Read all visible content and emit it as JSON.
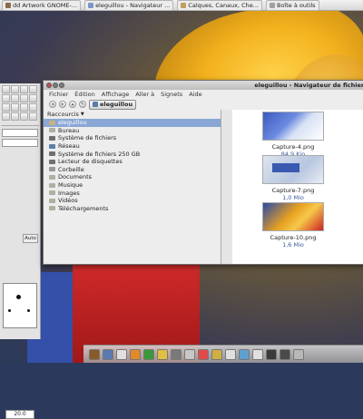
{
  "taskbar": {
    "tasks": [
      {
        "label": "dd Artwork GNOME-...",
        "kind": "gimp"
      },
      {
        "label": "eleguillou - Navigateur ...",
        "kind": "nav"
      },
      {
        "label": "Calques, Canaux, Che...",
        "kind": "layers"
      },
      {
        "label": "Boîte à outils",
        "kind": "tools"
      }
    ]
  },
  "toolbox": {
    "auto_label": "Auto",
    "brush_value": "20.0"
  },
  "window": {
    "title": "eleguillou - Navigateur de fichiers",
    "menu": [
      "Fichier",
      "Édition",
      "Affichage",
      "Aller à",
      "Signets",
      "Aide"
    ],
    "path_button": "eleguillou"
  },
  "sidebar": {
    "header": "Raccourcis",
    "items": [
      {
        "label": "eleguillou",
        "icon": "home-icon",
        "selected": true
      },
      {
        "label": "Bureau",
        "icon": "folder-icon"
      },
      {
        "label": "Système de fichiers",
        "icon": "disk-icon"
      },
      {
        "label": "Réseau",
        "icon": "network-icon"
      },
      {
        "label": "Système de fichiers 250 GB",
        "icon": "disk-icon"
      },
      {
        "label": "Lecteur de disquettes",
        "icon": "disk-icon"
      },
      {
        "label": "Corbeille",
        "icon": "trash-icon"
      },
      {
        "label": "Documents",
        "icon": "folder-icon"
      },
      {
        "label": "Musique",
        "icon": "folder-icon"
      },
      {
        "label": "Images",
        "icon": "folder-icon"
      },
      {
        "label": "Vidéos",
        "icon": "folder-icon"
      },
      {
        "label": "Téléchargements",
        "icon": "folder-icon"
      }
    ]
  },
  "files": [
    {
      "name": "Capture-4.png",
      "size": "84,9 Kio"
    },
    {
      "name": "Capture-7.png",
      "size": "1,0 Mio"
    },
    {
      "name": "Capture-10.png",
      "size": "1,6 Mio"
    }
  ]
}
